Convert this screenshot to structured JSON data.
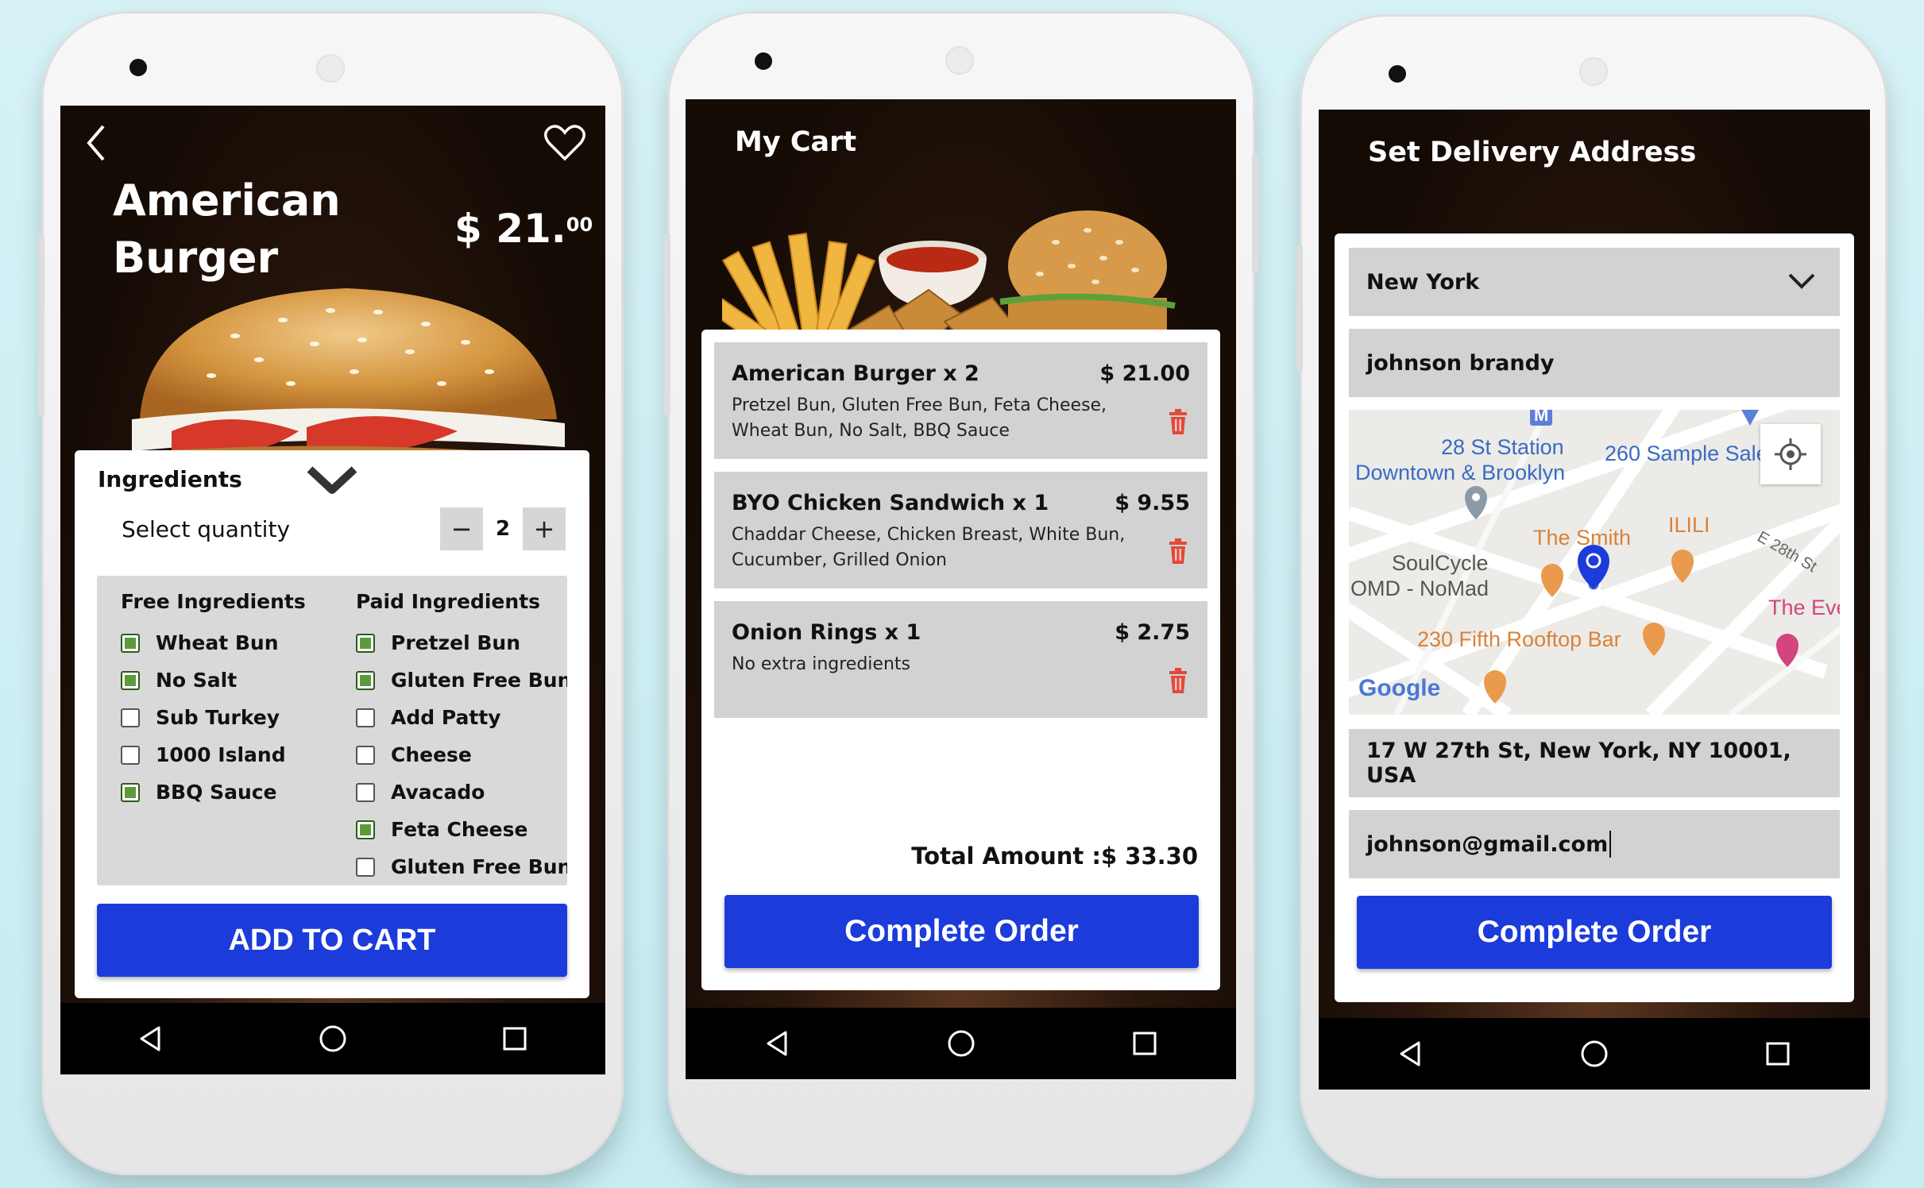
{
  "colors": {
    "accent_blue": "#1c3bdb",
    "check_green": "#5c9a3a",
    "trash_red": "#e04a3a",
    "field_gray": "#d2d2d2"
  },
  "screen1": {
    "product_name_line1": "American",
    "product_name_line2": "Burger",
    "price_main": "$ 21.",
    "price_cents": "00",
    "ingredients_label": "Ingredients",
    "select_quantity_label": "Select quantity",
    "quantity_value": "2",
    "minus_label": "−",
    "plus_label": "+",
    "free_header": "Free Ingredients",
    "paid_header": "Paid Ingredients",
    "free_ingredients": [
      {
        "label": "Wheat Bun",
        "checked": true
      },
      {
        "label": "No Salt",
        "checked": true
      },
      {
        "label": "Sub Turkey",
        "checked": false
      },
      {
        "label": "1000 Island",
        "checked": false
      },
      {
        "label": "BBQ Sauce",
        "checked": true
      }
    ],
    "paid_ingredients": [
      {
        "label": "Pretzel Bun",
        "checked": true
      },
      {
        "label": "Gluten Free Bun",
        "checked": true
      },
      {
        "label": "Add Patty",
        "checked": false
      },
      {
        "label": "Cheese",
        "checked": false
      },
      {
        "label": "Avacado",
        "checked": false
      },
      {
        "label": "Feta Cheese",
        "checked": true
      },
      {
        "label": "Gluten Free Bun",
        "checked": false
      }
    ],
    "add_to_cart_label": "ADD TO CART"
  },
  "screen2": {
    "title": "My Cart",
    "items": [
      {
        "name": "American Burger x 2",
        "price": "$ 21.00",
        "desc": "Pretzel Bun, Gluten Free Bun, Feta Cheese, Wheat Bun, No Salt, BBQ Sauce"
      },
      {
        "name": "BYO Chicken Sandwich x 1",
        "price": "$ 9.55",
        "desc": "Chaddar Cheese, Chicken Breast, White Bun, Cucumber, Grilled Onion"
      },
      {
        "name": "Onion Rings x 1",
        "price": "$ 2.75",
        "desc": "No extra ingredients"
      }
    ],
    "total_label": "Total Amount :$ 33.30",
    "complete_order_label": "Complete Order"
  },
  "screen3": {
    "title": "Set Delivery Address",
    "city_value": "New York",
    "name_value": "johnson brandy",
    "map_labels": {
      "station": "28 St Station",
      "downtown": "Downtown & Brooklyn",
      "sample_sale": "260 Sample Sale",
      "smith": "The Smith",
      "ilili": "ILILI",
      "street": "E 28th St",
      "soulcycle1": "SoulCycle",
      "soulcycle2": "OMD - NoMad",
      "the_eve": "The Eve",
      "rooftop": "230 Fifth Rooftop Bar",
      "google": "Google",
      "metro": "M"
    },
    "address_value": "17 W 27th St, New York, NY 10001, USA",
    "email_value": "johnson@gmail.com",
    "complete_order_label": "Complete Order"
  }
}
